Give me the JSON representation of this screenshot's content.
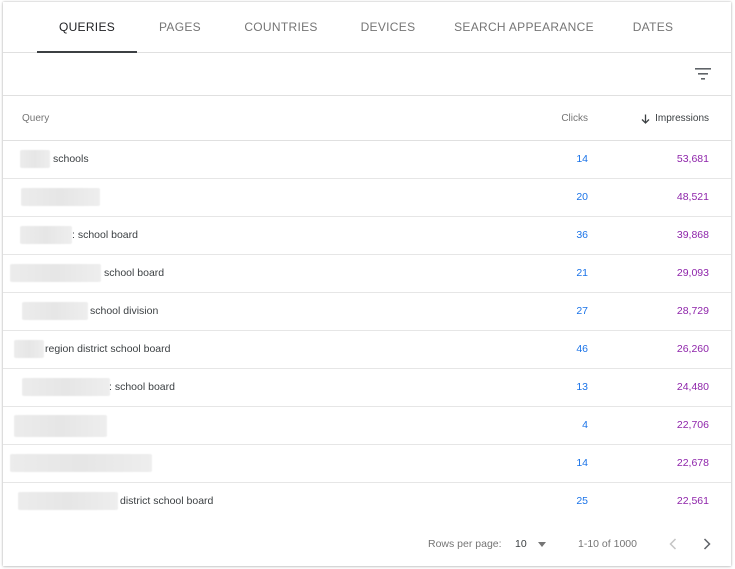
{
  "tabs": [
    {
      "label": "QUERIES",
      "active": true
    },
    {
      "label": "PAGES"
    },
    {
      "label": "COUNTRIES"
    },
    {
      "label": "DEVICES"
    },
    {
      "label": "SEARCH APPEARANCE"
    },
    {
      "label": "DATES"
    }
  ],
  "toolbar": {
    "filter_icon": "filter-list-icon"
  },
  "table": {
    "headers": {
      "query": "Query",
      "clicks": "Clicks",
      "impressions": "Impressions",
      "sort_icon": "arrow-downward-icon"
    },
    "rows": [
      {
        "query_visible": "schools",
        "clicks": "14",
        "impressions": "53,681"
      },
      {
        "query_visible": "",
        "clicks": "20",
        "impressions": "48,521"
      },
      {
        "query_visible": ": school board",
        "clicks": "36",
        "impressions": "39,868"
      },
      {
        "query_visible": "school board",
        "clicks": "21",
        "impressions": "29,093"
      },
      {
        "query_visible": "school division",
        "clicks": "27",
        "impressions": "28,729"
      },
      {
        "query_visible": "region district school board",
        "clicks": "46",
        "impressions": "26,260"
      },
      {
        "query_visible": ": school board",
        "clicks": "13",
        "impressions": "24,480"
      },
      {
        "query_visible": "",
        "clicks": "4",
        "impressions": "22,706"
      },
      {
        "query_visible": "",
        "clicks": "14",
        "impressions": "22,678"
      },
      {
        "query_visible": "district school board",
        "clicks": "25",
        "impressions": "22,561"
      }
    ]
  },
  "footer": {
    "rows_per_page_label": "Rows per page:",
    "rows_per_page_value": "10",
    "range_text": "1-10 of 1000"
  },
  "colors": {
    "clicks": "#1a73e8",
    "impressions": "#8e24aa"
  }
}
